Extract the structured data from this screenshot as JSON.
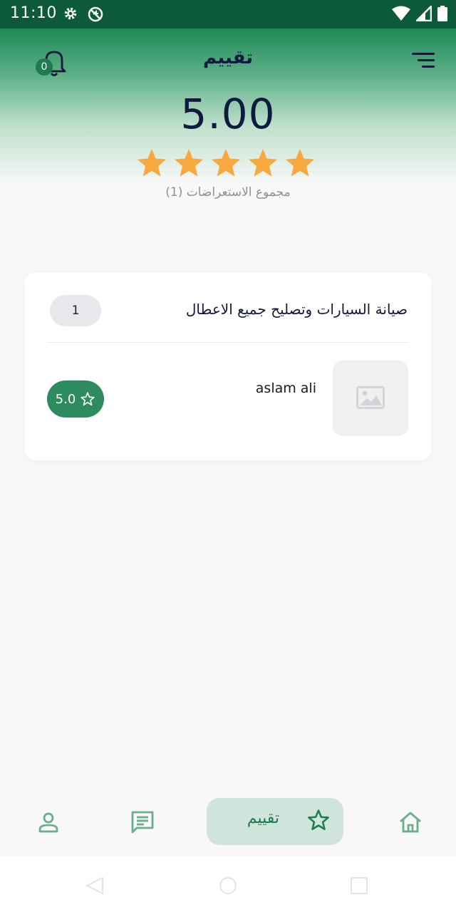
{
  "status_bar": {
    "time": "11:10",
    "left_icons": [
      "gear-icon",
      "no-sync-icon"
    ],
    "right_icons": [
      "wifi-icon",
      "signal-icon",
      "battery-icon"
    ]
  },
  "header": {
    "title": "تقييم",
    "notification_count": "0",
    "rating": "5.00",
    "stars_filled": 5,
    "stars_total": 5,
    "reviews_total": "مجموع الاستعراضات (1)"
  },
  "card": {
    "service_title": "صيانة السيارات وتصليح جميع الاعطال",
    "count": "1",
    "review": {
      "reviewer_name": "aslam ali",
      "score": "5.0",
      "thumbnail_icon": "image-placeholder-icon"
    }
  },
  "bottom_nav": {
    "items": [
      {
        "icon": "home-icon",
        "label": ""
      },
      {
        "icon": "star-icon",
        "label": "تقييم",
        "active": true
      },
      {
        "icon": "chat-icon",
        "label": ""
      },
      {
        "icon": "profile-icon",
        "label": ""
      }
    ]
  },
  "colors": {
    "primary": "#1e7a4f",
    "star": "#f9a83f",
    "title_text": "#0f1b3d",
    "active_nav_bg": "#cfe5dc"
  }
}
